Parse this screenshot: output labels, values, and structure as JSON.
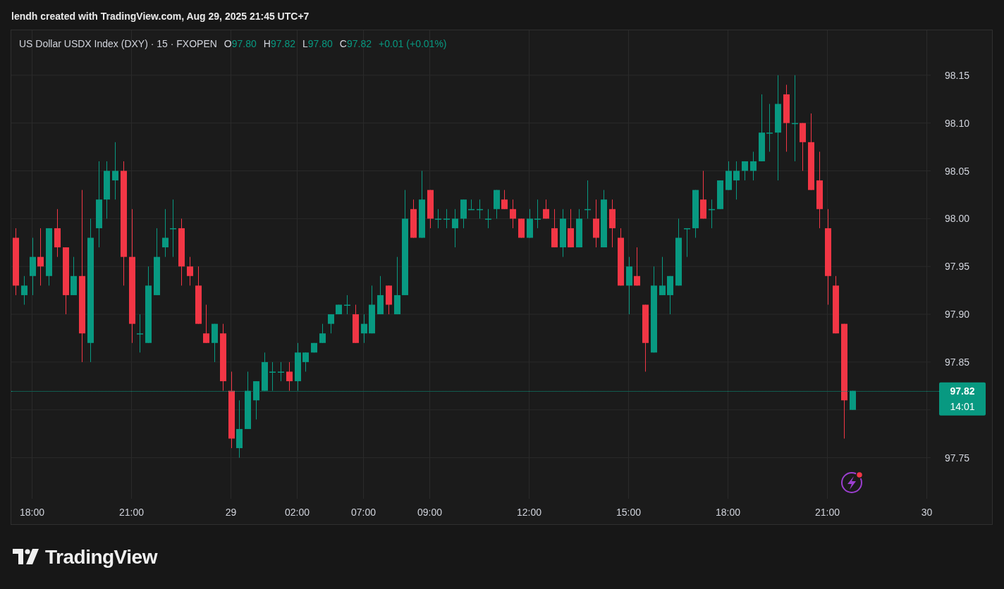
{
  "header": {
    "caption": "lendh created with TradingView.com, Aug 29, 2025 21:45 UTC+7"
  },
  "legend": {
    "symbol": "US Dollar USDX Index (DXY) · 15 · FXOPEN",
    "ohlc": [
      {
        "label": "O",
        "value": "97.80"
      },
      {
        "label": "H",
        "value": "97.82"
      },
      {
        "label": "L",
        "value": "97.80"
      },
      {
        "label": "C",
        "value": "97.82"
      }
    ],
    "change": "+0.01 (+0.01%)"
  },
  "chart": {
    "chart_data": {
      "type": "candlestick",
      "ylim": [
        97.707,
        98.197
      ],
      "grid": true,
      "yticks": [
        {
          "value": 97.75,
          "label": "97.75"
        },
        {
          "value": 97.85,
          "label": "97.85"
        },
        {
          "value": 97.9,
          "label": "97.90"
        },
        {
          "value": 97.95,
          "label": "97.95"
        },
        {
          "value": 98.0,
          "label": "98.00"
        },
        {
          "value": 98.05,
          "label": "98.05"
        },
        {
          "value": 98.1,
          "label": "98.10"
        },
        {
          "value": 98.15,
          "label": "98.15"
        }
      ],
      "categories": [
        null,
        null,
        "18:00",
        null,
        null,
        null,
        null,
        null,
        null,
        null,
        null,
        null,
        null,
        null,
        "21:00",
        null,
        null,
        null,
        null,
        null,
        null,
        null,
        null,
        null,
        null,
        null,
        "29",
        null,
        null,
        null,
        null,
        null,
        null,
        null,
        "02:00",
        null,
        null,
        null,
        null,
        null,
        null,
        null,
        "07:00",
        null,
        null,
        null,
        null,
        null,
        null,
        null,
        "09:00",
        null,
        null,
        null,
        null,
        null,
        null,
        null,
        null,
        null,
        null,
        null,
        "12:00",
        null,
        null,
        null,
        null,
        null,
        null,
        null,
        null,
        null,
        null,
        null,
        "15:00",
        null,
        null,
        null,
        null,
        null,
        null,
        null,
        null,
        null,
        null,
        null,
        "18:00",
        null,
        null,
        null,
        null,
        null,
        null,
        null,
        null,
        null,
        null,
        null,
        "21:00",
        null,
        null,
        null,
        null,
        null,
        null,
        null,
        null,
        null,
        null,
        null,
        "30"
      ],
      "ohlc": [
        [
          97.98,
          97.99,
          97.92,
          97.93
        ],
        [
          97.92,
          97.94,
          97.91,
          97.93
        ],
        [
          97.94,
          97.98,
          97.92,
          97.96
        ],
        [
          97.96,
          97.99,
          97.93,
          97.95
        ],
        [
          97.94,
          97.99,
          97.93,
          97.99
        ],
        [
          97.99,
          98.01,
          97.96,
          97.97
        ],
        [
          97.97,
          97.97,
          97.9,
          97.92
        ],
        [
          97.92,
          97.96,
          97.92,
          97.94
        ],
        [
          97.94,
          98.03,
          97.85,
          97.88
        ],
        [
          97.87,
          98.0,
          97.85,
          97.98
        ],
        [
          97.99,
          98.06,
          97.97,
          98.02
        ],
        [
          98.02,
          98.06,
          98.0,
          98.05
        ],
        [
          98.04,
          98.08,
          98.02,
          98.05
        ],
        [
          98.05,
          98.06,
          97.93,
          97.96
        ],
        [
          97.96,
          98.01,
          97.87,
          97.89
        ],
        [
          97.88,
          97.9,
          97.86,
          97.88
        ],
        [
          97.87,
          97.95,
          97.87,
          97.93
        ],
        [
          97.92,
          97.99,
          97.92,
          97.96
        ],
        [
          97.97,
          98.01,
          97.96,
          97.98
        ],
        [
          97.99,
          98.02,
          97.96,
          97.99
        ],
        [
          97.99,
          98.0,
          97.93,
          97.95
        ],
        [
          97.95,
          97.96,
          97.93,
          97.94
        ],
        [
          97.93,
          97.95,
          97.89,
          97.89
        ],
        [
          97.88,
          97.91,
          97.87,
          97.87
        ],
        [
          97.87,
          97.89,
          97.85,
          97.89
        ],
        [
          97.88,
          97.89,
          97.82,
          97.83
        ],
        [
          97.82,
          97.84,
          97.76,
          97.77
        ],
        [
          97.76,
          97.81,
          97.75,
          97.78
        ],
        [
          97.78,
          97.84,
          97.78,
          97.82
        ],
        [
          97.81,
          97.83,
          97.79,
          97.83
        ],
        [
          97.82,
          97.86,
          97.82,
          97.85
        ],
        [
          97.84,
          97.85,
          97.82,
          97.84
        ],
        [
          97.84,
          97.85,
          97.83,
          97.84
        ],
        [
          97.84,
          97.85,
          97.82,
          97.83
        ],
        [
          97.83,
          97.87,
          97.82,
          97.86
        ],
        [
          97.85,
          97.86,
          97.84,
          97.86
        ],
        [
          97.86,
          97.87,
          97.86,
          97.87
        ],
        [
          97.87,
          97.89,
          97.87,
          97.88
        ],
        [
          97.89,
          97.9,
          97.88,
          97.9
        ],
        [
          97.9,
          97.91,
          97.9,
          97.91
        ],
        [
          97.91,
          97.92,
          97.9,
          97.91
        ],
        [
          97.9,
          97.91,
          97.87,
          97.87
        ],
        [
          97.88,
          97.9,
          97.87,
          97.89
        ],
        [
          97.88,
          97.93,
          97.88,
          97.91
        ],
        [
          97.9,
          97.94,
          97.9,
          97.92
        ],
        [
          97.93,
          97.93,
          97.9,
          97.91
        ],
        [
          97.9,
          97.96,
          97.9,
          97.92
        ],
        [
          97.92,
          98.03,
          97.92,
          98.0
        ],
        [
          98.01,
          98.02,
          97.98,
          97.98
        ],
        [
          97.98,
          98.05,
          97.98,
          98.02
        ],
        [
          98.03,
          98.03,
          97.99,
          98.0
        ],
        [
          98.0,
          98.01,
          97.99,
          98.0
        ],
        [
          98.0,
          98.01,
          97.99,
          98.0
        ],
        [
          97.99,
          98.01,
          97.97,
          98.0
        ],
        [
          98.0,
          98.02,
          97.99,
          98.02
        ],
        [
          98.01,
          98.02,
          98.01,
          98.01
        ],
        [
          98.01,
          98.02,
          98.0,
          98.01
        ],
        [
          98.0,
          98.01,
          97.99,
          98.0
        ],
        [
          98.01,
          98.03,
          98.0,
          98.03
        ],
        [
          98.02,
          98.03,
          98.01,
          98.01
        ],
        [
          98.01,
          98.02,
          97.99,
          98.0
        ],
        [
          98.0,
          98.0,
          97.98,
          97.98
        ],
        [
          97.98,
          98.01,
          97.98,
          98.0
        ],
        [
          98.0,
          98.02,
          97.99,
          98.0
        ],
        [
          98.01,
          98.02,
          98.0,
          98.0
        ],
        [
          97.99,
          98.01,
          97.97,
          97.97
        ],
        [
          97.97,
          98.01,
          97.96,
          98.0
        ],
        [
          97.99,
          98.01,
          97.97,
          97.97
        ],
        [
          97.97,
          98.01,
          97.97,
          98.0
        ],
        [
          98.01,
          98.04,
          98.0,
          98.01
        ],
        [
          98.0,
          98.02,
          97.97,
          97.98
        ],
        [
          97.97,
          98.03,
          97.97,
          98.02
        ],
        [
          98.01,
          98.02,
          97.97,
          97.99
        ],
        [
          97.98,
          97.99,
          97.93,
          97.93
        ],
        [
          97.93,
          97.96,
          97.9,
          97.95
        ],
        [
          97.94,
          97.97,
          97.93,
          97.93
        ],
        [
          97.91,
          97.91,
          97.84,
          97.87
        ],
        [
          97.86,
          97.95,
          97.86,
          97.93
        ],
        [
          97.92,
          97.96,
          97.92,
          97.93
        ],
        [
          97.92,
          97.94,
          97.9,
          97.94
        ],
        [
          97.93,
          98.0,
          97.93,
          97.98
        ],
        [
          97.99,
          97.99,
          97.96,
          97.99
        ],
        [
          97.99,
          98.03,
          97.98,
          98.03
        ],
        [
          98.02,
          98.05,
          98.0,
          98.0
        ],
        [
          98.01,
          98.02,
          97.99,
          98.01
        ],
        [
          98.01,
          98.04,
          98.01,
          98.04
        ],
        [
          98.03,
          98.06,
          98.03,
          98.05
        ],
        [
          98.04,
          98.06,
          98.02,
          98.05
        ],
        [
          98.05,
          98.06,
          98.04,
          98.06
        ],
        [
          98.05,
          98.07,
          98.04,
          98.06
        ],
        [
          98.06,
          98.13,
          98.06,
          98.09
        ],
        [
          98.09,
          98.12,
          98.07,
          98.09
        ],
        [
          98.09,
          98.15,
          98.04,
          98.12
        ],
        [
          98.13,
          98.14,
          98.07,
          98.1
        ],
        [
          98.1,
          98.15,
          98.06,
          98.1
        ],
        [
          98.1,
          98.1,
          98.05,
          98.08
        ],
        [
          98.08,
          98.11,
          98.03,
          98.03
        ],
        [
          98.04,
          98.07,
          97.99,
          98.01
        ],
        [
          97.99,
          98.01,
          97.91,
          97.94
        ],
        [
          97.93,
          97.94,
          97.88,
          97.88
        ],
        [
          97.89,
          97.89,
          97.77,
          97.81
        ],
        [
          97.8,
          97.82,
          97.8,
          97.82
        ],
        null,
        null,
        null,
        null,
        null,
        null,
        null,
        null,
        null
      ]
    },
    "last_price": {
      "price_label": "97.82",
      "countdown": "14:01"
    }
  },
  "footer": {
    "brand": "TradingView"
  }
}
